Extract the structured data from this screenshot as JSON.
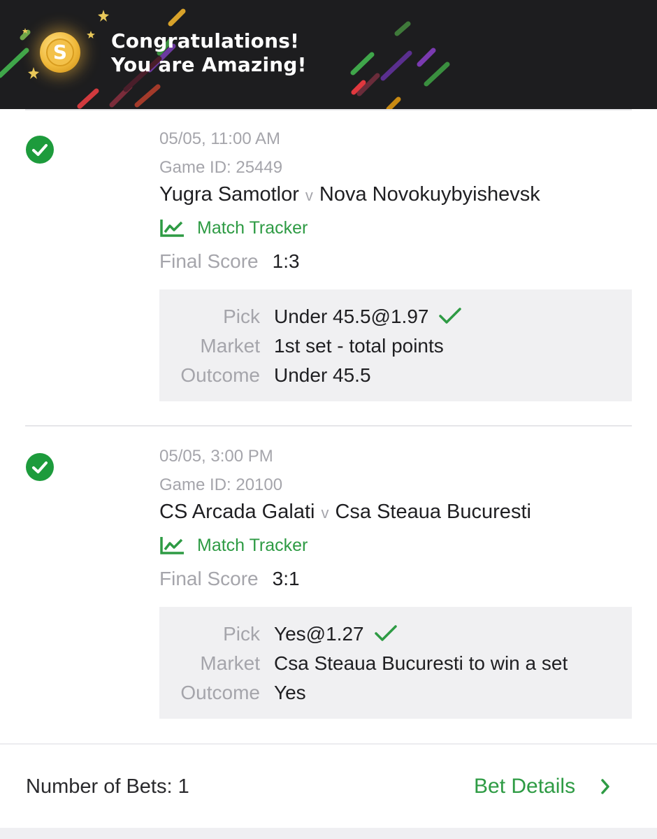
{
  "banner": {
    "title_line1": "Congratulations!",
    "title_line2": "You are Amazing!",
    "coin_icon": "dollar-coin-icon",
    "colors": {
      "background": "#1d1d1f",
      "coin": "#f0b93a"
    }
  },
  "bets": [
    {
      "status": "won",
      "datetime": "05/05, 11:00 AM",
      "game_id": "Game ID: 25449",
      "home": "Yugra Samotlor",
      "vs": "v",
      "away": "Nova Novokuybyishevsk",
      "tracker_label": "Match Tracker",
      "final_score_label": "Final Score",
      "final_score": "1:3",
      "pick_label": "Pick",
      "pick": "Under 45.5@1.97",
      "market_label": "Market",
      "market": "1st set - total points",
      "outcome_label": "Outcome",
      "outcome": "Under 45.5"
    },
    {
      "status": "won",
      "datetime": "05/05, 3:00 PM",
      "game_id": "Game ID: 20100",
      "home": "CS Arcada Galati",
      "vs": "v",
      "away": "Csa Steaua Bucuresti",
      "tracker_label": "Match Tracker",
      "final_score_label": "Final Score",
      "final_score": "3:1",
      "pick_label": "Pick",
      "pick": "Yes@1.27",
      "market_label": "Market",
      "market": "Csa Steaua Bucuresti to win a set",
      "outcome_label": "Outcome",
      "outcome": "Yes"
    }
  ],
  "footer": {
    "bets_count": "Number of Bets: 1",
    "details_label": "Bet Details"
  },
  "colors": {
    "accent_green": "#2e9b44",
    "won_green": "#1d9b3c",
    "muted": "#a5a5ab"
  }
}
